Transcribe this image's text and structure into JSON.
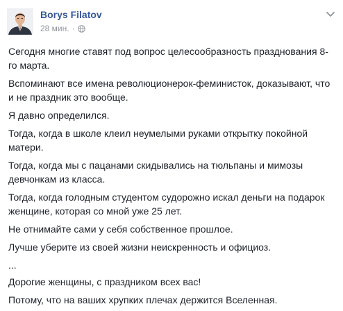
{
  "post": {
    "author": "Borys Filatov",
    "time": "28 мин.",
    "separator": "·",
    "privacy_icon": "globe-icon",
    "menu_icon": "chevron-down-icon",
    "paragraphs": [
      "Сегодня многие ставят под вопрос целесообразность празднования 8-го марта.",
      "Вспоминают все имена революционерок-феминисток, доказывают, что и не праздник это вообще.",
      "Я давно определился.",
      "Тогда, когда в школе клеил неумелыми руками открытку покойной матери.",
      "Тогда, когда мы с пацанами скидывались на тюльпаны и мимозы девчонкам из класса.",
      "Тогда, когда голодным студентом судорожно искал деньги на подарок женщине, которая со мной уже 25 лет.",
      "Не отнимайте сами у себя собственное прошлое.",
      "Лучше уберите из своей жизни неискренность и официоз.",
      "...",
      "Дорогие женщины, с праздником всех вас!",
      "Потому, что на ваших хрупких плечах держится Вселенная."
    ]
  },
  "colors": {
    "author_link": "#365899",
    "meta_text": "#90949c",
    "body_text": "#1d2129"
  }
}
